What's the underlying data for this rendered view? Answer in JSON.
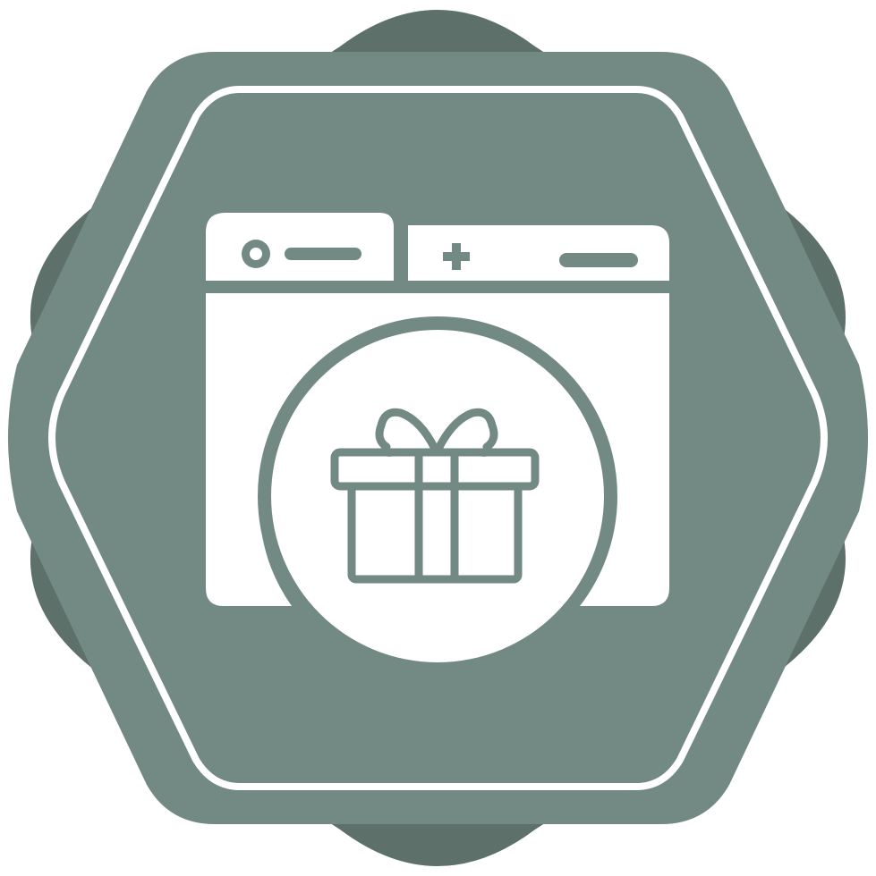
{
  "icon": {
    "name": "browser-gift-icon",
    "depicts": [
      "browser-window",
      "browser-tab",
      "add-tab",
      "gift-box"
    ]
  },
  "colors": {
    "background": "#ffffff",
    "badge_back": "#5e706a",
    "badge_front": "#738a84",
    "foreground": "#ffffff"
  }
}
